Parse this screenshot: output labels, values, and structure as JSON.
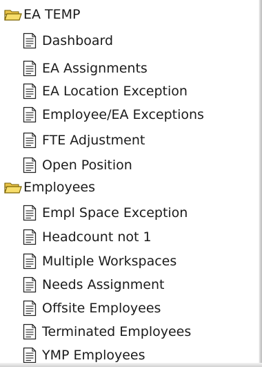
{
  "tree": {
    "folders": [
      {
        "label": "EA TEMP",
        "items": [
          {
            "label": "Dashboard"
          },
          {
            "label": "EA Assignments"
          },
          {
            "label": "EA Location Exception"
          },
          {
            "label": "Employee/EA Exceptions"
          },
          {
            "label": "FTE Adjustment"
          },
          {
            "label": "Open Position"
          }
        ]
      },
      {
        "label": "Employees",
        "items": [
          {
            "label": "Empl Space Exception"
          },
          {
            "label": "Headcount not 1"
          },
          {
            "label": "Multiple Workspaces"
          },
          {
            "label": "Needs Assignment"
          },
          {
            "label": "Offsite Employees"
          },
          {
            "label": "Terminated Employees"
          },
          {
            "label": "YMP Employees"
          }
        ]
      }
    ]
  },
  "icons": {
    "folder": "open-folder-icon",
    "document": "document-icon"
  },
  "colors": {
    "folder_fill": "#f7dd6b",
    "folder_stroke": "#7a6200",
    "text": "#1a1a1a"
  }
}
